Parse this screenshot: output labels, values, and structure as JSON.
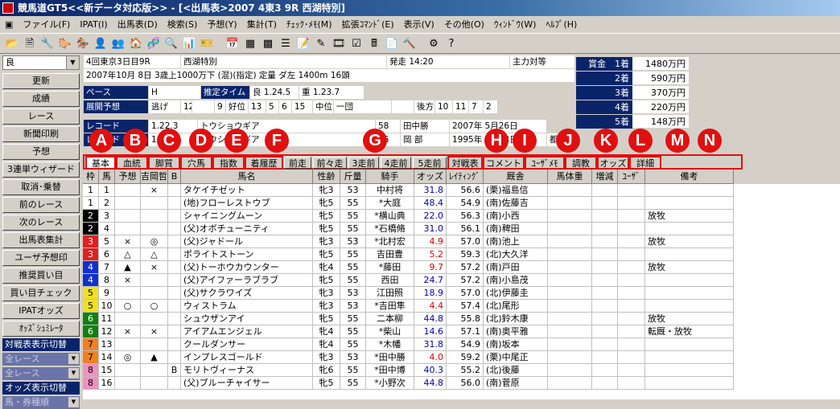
{
  "window": {
    "title": "競馬道GT5<<新データ対応版>> - [<出馬表>2007 4東3 9R 西湖特別]"
  },
  "menu": [
    "ファイル(F)",
    "IPAT(I)",
    "出馬表(D)",
    "検索(S)",
    "予想(Y)",
    "集計(T)",
    "ﾁｪｯｸ･ﾒﾓ(M)",
    "拡張ｺﾏﾝﾄﾞ(E)",
    "表示(V)",
    "その他(O)",
    "ｳｨﾝﾄﾞｳ(W)",
    "ﾍﾙﾌﾟ(H)"
  ],
  "toolbar_icons": [
    "open-icon",
    "new-icon",
    "tool-icon",
    "horse-icon",
    "jockey-icon",
    "trainer-icon",
    "owner-icon",
    "breeder-icon",
    "sire-icon",
    "search-icon",
    "chart-icon",
    "ticket-icon",
    "calendar-icon",
    "table-icon",
    "grid-icon",
    "list-icon",
    "memo-icon",
    "note-icon",
    "film-icon",
    "check-icon",
    "calc-icon",
    "doc-icon",
    "wrench-icon",
    "settings-icon",
    "help-icon"
  ],
  "sidebar": {
    "track_condition": "良",
    "buttons": [
      "更新",
      "成績",
      "レース",
      "新聞印刷",
      "予想",
      "3連単ウィザード",
      "取消･乗替",
      "前のレース",
      "次のレース",
      "出馬表集計",
      "ユーザ予想印",
      "推奨買い目",
      "買い目チェック",
      "IPATオッズ",
      "ｵｯｽﾞｼｭﾐﾚｰﾀ"
    ],
    "section1_label": "対戦表表示切替",
    "section1_selects": [
      "全レース",
      "全レース"
    ],
    "section2_label": "オッズ表示切替",
    "section2_select": "馬・券種順"
  },
  "race": {
    "header": "4回東京3日目9R",
    "name": "西湖特別",
    "post_time": "発走 14:20",
    "main_opponent": "主力対等",
    "detail": "2007年10月 8日 3歳上1000万下 (混)(指定) 定量 ダ左 1400m 16頭",
    "pace_label": "ペース",
    "pace": "H",
    "est_time_label": "推定タイム",
    "est_time_good": "良 1.24.5",
    "est_time_heavy": "重 1.23.7",
    "dev_label": "展開予想",
    "dev": [
      "逃げ",
      "12",
      "",
      "9",
      "好位",
      "13",
      "5",
      "6",
      "15",
      "中位",
      "一団",
      "",
      "後方",
      "10",
      "11",
      "7",
      "2"
    ],
    "record_label": "レコード",
    "record_time": "1.22.3",
    "record_horse": "トウショウギア",
    "record_weight": "58",
    "record_jockey": "田中勝",
    "record_date": "2007年 5月26日",
    "record2_label": "レコード",
    "record2_time": "1.22.3",
    "record2_horse": "トウショウギア",
    "record2_weight": "56",
    "record2_jockey": "岡 部",
    "record2_date": "1995年 4月28日",
    "record2_extra": "都"
  },
  "prize": [
    {
      "label": "賞金　1着",
      "value": "1480万円"
    },
    {
      "label": "2着",
      "value": "590万円"
    },
    {
      "label": "3着",
      "value": "370万円"
    },
    {
      "label": "4着",
      "value": "220万円"
    },
    {
      "label": "5着",
      "value": "148万円"
    }
  ],
  "tabs": [
    "基本",
    "血統",
    "脚質",
    "穴馬",
    "指数",
    "着履歴",
    "前走",
    "前々走",
    "3走前",
    "4走前",
    "5走前",
    "対戦表",
    "コメント",
    "ﾕｰｻﾞﾒﾓ",
    "調教",
    "オッズ",
    "詳細"
  ],
  "annotations": [
    "A",
    "B",
    "C",
    "D",
    "E",
    "F",
    "G",
    "H",
    "I",
    "J",
    "K",
    "L",
    "M",
    "N"
  ],
  "columns": [
    "枠",
    "馬",
    "予想",
    "吉岡哲",
    "B",
    "馬名",
    "性齢",
    "斤量",
    "騎手",
    "オッズ",
    "ﾚｲﾃｨﾝｸﾞ",
    "厩舎",
    "馬体重",
    "増減",
    "ﾕｰｻﾞ",
    "備考"
  ],
  "frame_colors": {
    "1": "#ffffff",
    "2": "#000000",
    "3": "#e02020",
    "4": "#1030d0",
    "5": "#f0e020",
    "6": "#108010",
    "7": "#f08020",
    "8": "#f090c0"
  },
  "horses": [
    {
      "waku": "1",
      "no": "1",
      "pred": "",
      "yoshioka": "×",
      "b": "",
      "name": "タケイチゼット",
      "sex": "牝3",
      "wt": "53",
      "jockey": "中村将",
      "odds": "31.8",
      "rating": "56.6",
      "stable": "(栗)福島信",
      "note": ""
    },
    {
      "waku": "1",
      "no": "2",
      "pred": "",
      "yoshioka": "",
      "b": "",
      "name": "(地)フローレストウブ",
      "sex": "牝5",
      "wt": "55",
      "jockey": "*大庭",
      "odds": "48.4",
      "rating": "54.9",
      "stable": "(南)佐藤吉",
      "note": ""
    },
    {
      "waku": "2",
      "no": "3",
      "pred": "",
      "yoshioka": "",
      "b": "",
      "name": "シャイニングムーン",
      "sex": "牝5",
      "wt": "55",
      "jockey": "*横山典",
      "odds": "22.0",
      "rating": "56.3",
      "stable": "(南)小西",
      "note": "放牧"
    },
    {
      "waku": "2",
      "no": "4",
      "pred": "",
      "yoshioka": "",
      "b": "",
      "name": "(父)オボチューニティ",
      "sex": "牝5",
      "wt": "55",
      "jockey": "*石橋脩",
      "odds": "31.0",
      "rating": "56.1",
      "stable": "(南)稗田",
      "note": ""
    },
    {
      "waku": "3",
      "no": "5",
      "pred": "×",
      "yoshioka": "◎",
      "b": "",
      "name": "(父)ジャドール",
      "sex": "牝3",
      "wt": "53",
      "jockey": "*北村宏",
      "odds": "4.9",
      "rating": "57.0",
      "stable": "(南)池上",
      "note": "放牧"
    },
    {
      "waku": "3",
      "no": "6",
      "pred": "△",
      "yoshioka": "△",
      "b": "",
      "name": "ポライトストーン",
      "sex": "牝5",
      "wt": "55",
      "jockey": "吉田豊",
      "odds": "5.2",
      "rating": "59.3",
      "stable": "(北)大久洋",
      "note": ""
    },
    {
      "waku": "4",
      "no": "7",
      "pred": "▲",
      "yoshioka": "×",
      "b": "",
      "name": "(父)トーホウカウンター",
      "sex": "牝4",
      "wt": "55",
      "jockey": "*藤田",
      "odds": "9.7",
      "rating": "57.2",
      "stable": "(南)戸田",
      "note": "放牧"
    },
    {
      "waku": "4",
      "no": "8",
      "pred": "×",
      "yoshioka": "",
      "b": "",
      "name": "(父)アイファーラブラブ",
      "sex": "牝5",
      "wt": "55",
      "jockey": "西田",
      "odds": "24.7",
      "rating": "57.2",
      "stable": "(南)小島茂",
      "note": ""
    },
    {
      "waku": "5",
      "no": "9",
      "pred": "",
      "yoshioka": "",
      "b": "",
      "name": "(父)サクラワイズ",
      "sex": "牝3",
      "wt": "53",
      "jockey": "江田照",
      "odds": "18.9",
      "rating": "57.0",
      "stable": "(北)伊藤圭",
      "note": ""
    },
    {
      "waku": "5",
      "no": "10",
      "pred": "○",
      "yoshioka": "○",
      "b": "",
      "name": "ウィストラム",
      "sex": "牝3",
      "wt": "53",
      "jockey": "*吉田隼",
      "odds": "4.4",
      "rating": "57.4",
      "stable": "(北)尾形",
      "note": ""
    },
    {
      "waku": "6",
      "no": "11",
      "pred": "",
      "yoshioka": "",
      "b": "",
      "name": "シュウザンアイ",
      "sex": "牝5",
      "wt": "55",
      "jockey": "二本柳",
      "odds": "44.8",
      "rating": "55.8",
      "stable": "(北)鈴木康",
      "note": "放牧"
    },
    {
      "waku": "6",
      "no": "12",
      "pred": "×",
      "yoshioka": "×",
      "b": "",
      "name": "アイアムエンジェル",
      "sex": "牝4",
      "wt": "55",
      "jockey": "*柴山",
      "odds": "14.6",
      "rating": "57.1",
      "stable": "(南)奥平雅",
      "note": "転厩・放牧"
    },
    {
      "waku": "7",
      "no": "13",
      "pred": "",
      "yoshioka": "",
      "b": "",
      "name": "クールダンサー",
      "sex": "牝4",
      "wt": "55",
      "jockey": "*木幡",
      "odds": "31.8",
      "rating": "54.9",
      "stable": "(南)坂本",
      "note": ""
    },
    {
      "waku": "7",
      "no": "14",
      "pred": "◎",
      "yoshioka": "▲",
      "b": "",
      "name": "インプレスゴールド",
      "sex": "牝3",
      "wt": "53",
      "jockey": "*田中勝",
      "odds": "4.0",
      "rating": "59.2",
      "stable": "(栗)中尾正",
      "note": ""
    },
    {
      "waku": "8",
      "no": "15",
      "pred": "",
      "yoshioka": "",
      "b": "B",
      "name": "モリトヴィーナス",
      "sex": "牝6",
      "wt": "55",
      "jockey": "*田中博",
      "odds": "40.3",
      "rating": "55.2",
      "stable": "(北)後藤",
      "note": ""
    },
    {
      "waku": "8",
      "no": "16",
      "pred": "",
      "yoshioka": "",
      "b": "",
      "name": "(父)ブルーチャイサー",
      "sex": "牝5",
      "wt": "55",
      "jockey": "*小野次",
      "odds": "44.8",
      "rating": "56.0",
      "stable": "(南)菅原",
      "note": ""
    }
  ]
}
